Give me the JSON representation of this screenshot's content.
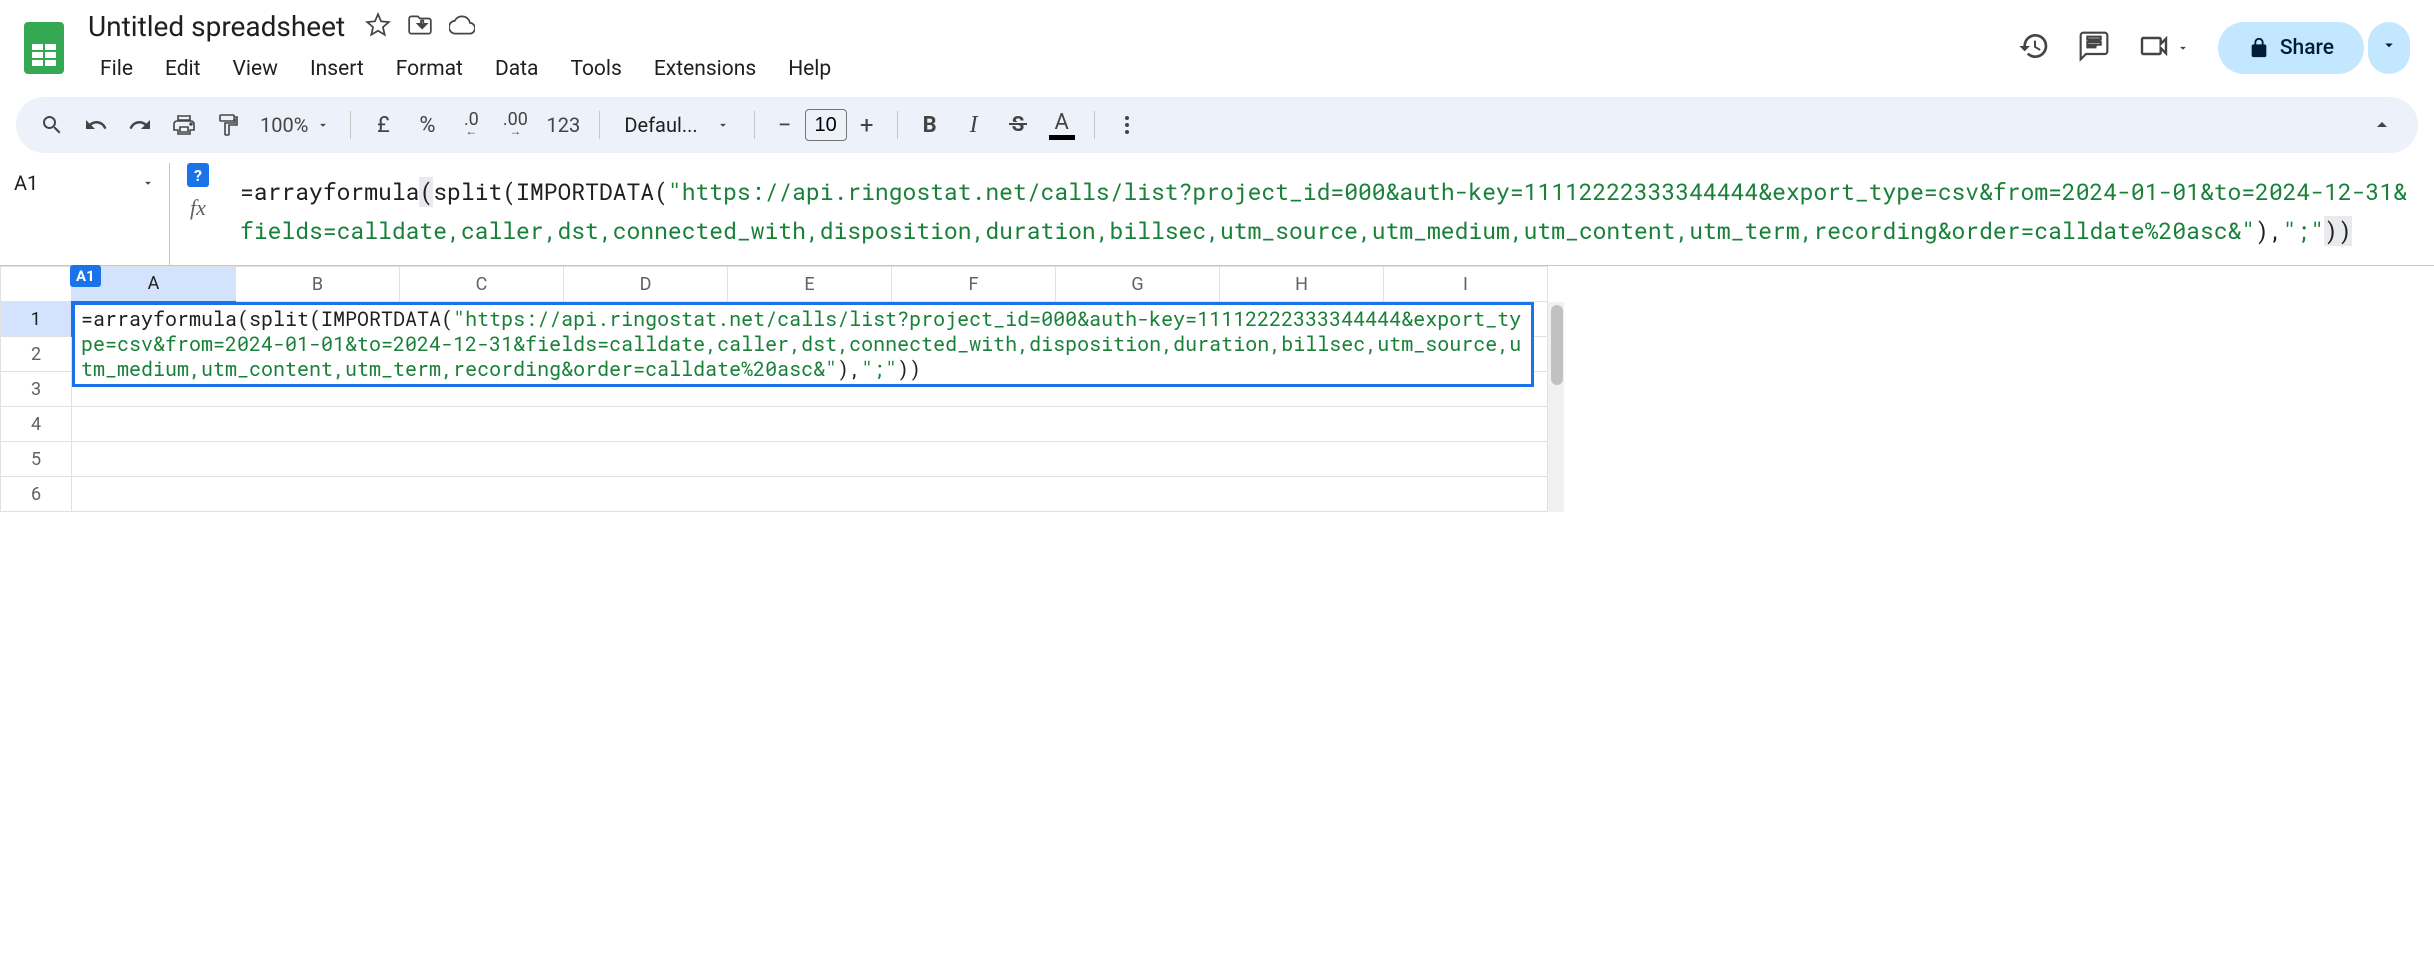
{
  "header": {
    "title": "Untitled spreadsheet",
    "menu": [
      "File",
      "Edit",
      "View",
      "Insert",
      "Format",
      "Data",
      "Tools",
      "Extensions",
      "Help"
    ],
    "share_label": "Share"
  },
  "toolbar": {
    "zoom": "100%",
    "currency1": "£",
    "currency2": "%",
    "dec_dec": ".0",
    "dec_inc": ".00",
    "num_fmt": "123",
    "font": "Defaul...",
    "font_size": "10",
    "bold": "B",
    "italic": "I",
    "text_letter": "A"
  },
  "formula_bar": {
    "name_box": "A1",
    "help_badge": "?",
    "fx": "fx",
    "prefix": "=arrayformula",
    "paren_open": "(",
    "mid1": "split(IMPORTDATA(",
    "url": "\"https://api.ringostat.net/calls/list?project_id=000&auth-key=11112222333344444&export_type=csv&from=2024-01-01&to=2024-12-31&fields=calldate,caller,dst,connected_with,disposition,duration,billsec,utm_source,utm_medium,utm_content,utm_term,recording&order=calldate%20asc&\"",
    "mid2": "),",
    "sep": "\";\"",
    "close": "))"
  },
  "grid": {
    "columns": [
      "A",
      "B",
      "C",
      "D",
      "E",
      "F",
      "G",
      "H",
      "I"
    ],
    "rows": [
      "1",
      "2",
      "3",
      "4",
      "5",
      "6"
    ],
    "active_badge": "A1",
    "cell_a1_prefix": "=arrayformula(split(IMPORTDATA(",
    "cell_a1_url": "\"https://api.ringostat.net/calls/list?project_id=000&auth-key=11112222333344444&export_type=csv&from=2024-01-01&to=2024-12-31&fields=calldate,caller,dst,connected_with,disposition,duration,billsec,utm_source,utm_medium,utm_content,utm_term,recording&order=calldate%20asc&\"",
    "cell_a1_mid": "),",
    "cell_a1_sep": "\";\"",
    "cell_a1_close": "))"
  }
}
